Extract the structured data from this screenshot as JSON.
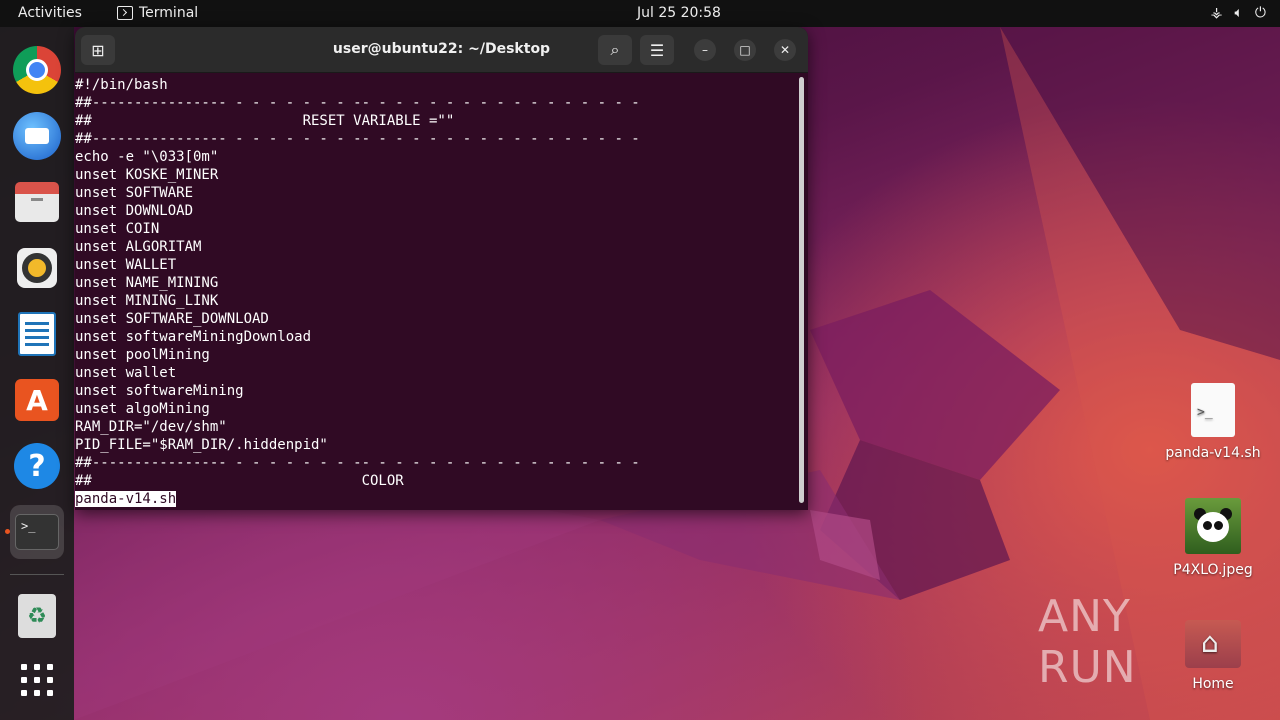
{
  "topbar": {
    "activities": "Activities",
    "app_name": "Terminal",
    "clock": "Jul 25  20:58",
    "tray": [
      "network-icon",
      "volume-icon",
      "power-icon"
    ]
  },
  "dock": {
    "items": [
      {
        "name": "chrome",
        "icon": "chrome-icon"
      },
      {
        "name": "thunderbird",
        "icon": "thunderbird-icon"
      },
      {
        "name": "files",
        "icon": "files-icon"
      },
      {
        "name": "rhythmbox",
        "icon": "rhythmbox-icon"
      },
      {
        "name": "libreoffice-writer",
        "icon": "writer-icon"
      },
      {
        "name": "app-center",
        "icon": "app-center-icon"
      },
      {
        "name": "help",
        "icon": "help-icon"
      },
      {
        "name": "terminal",
        "icon": "terminal-icon",
        "active": true
      },
      {
        "name": "trash",
        "icon": "trash-icon"
      },
      {
        "name": "show-apps",
        "icon": "app-grid-icon"
      }
    ],
    "terminal_glyph": ">_",
    "help_glyph": "?",
    "store_glyph": "A",
    "trash_glyph": "♻"
  },
  "terminal": {
    "title": "user@ubuntu22: ~/Desktop",
    "lines": [
      "#!/bin/bash",
      "##---------------- - - - - - - - -- - - - - - - - - - - - - - - - -",
      "##                         RESET VARIABLE =\"\"",
      "##---------------- - - - - - - - -- - - - - - - - - - - - - - - - -",
      "echo -e \"\\033[0m\"",
      "unset KOSKE_MINER",
      "unset SOFTWARE",
      "unset DOWNLOAD",
      "unset COIN",
      "unset ALGORITAM",
      "unset WALLET",
      "unset NAME_MINING",
      "unset MINING_LINK",
      "unset SOFTWARE_DOWNLOAD",
      "unset softwareMiningDownload",
      "unset poolMining",
      "unset wallet",
      "unset softwareMining",
      "unset algoMining",
      "RAM_DIR=\"/dev/shm\"",
      "PID_FILE=\"$RAM_DIR/.hiddenpid\"",
      "##---------------- - - - - - - - -- - - - - - - - - - - - - - - - -",
      "##                                COLOR"
    ],
    "status_line": "panda-v14.sh"
  },
  "desktop": {
    "icons": [
      {
        "label": "panda-v14.sh",
        "type": "shell-script",
        "glyph": ">_"
      },
      {
        "label": "P4XLO.jpeg",
        "type": "image"
      },
      {
        "label": "Home",
        "type": "folder"
      }
    ]
  },
  "watermark": {
    "text": "ANY RUN"
  },
  "colors": {
    "terminal_bg": "#300a24",
    "terminal_fg": "#ffffff",
    "header_bg": "#2b2b2b",
    "accent": "#e95420"
  }
}
